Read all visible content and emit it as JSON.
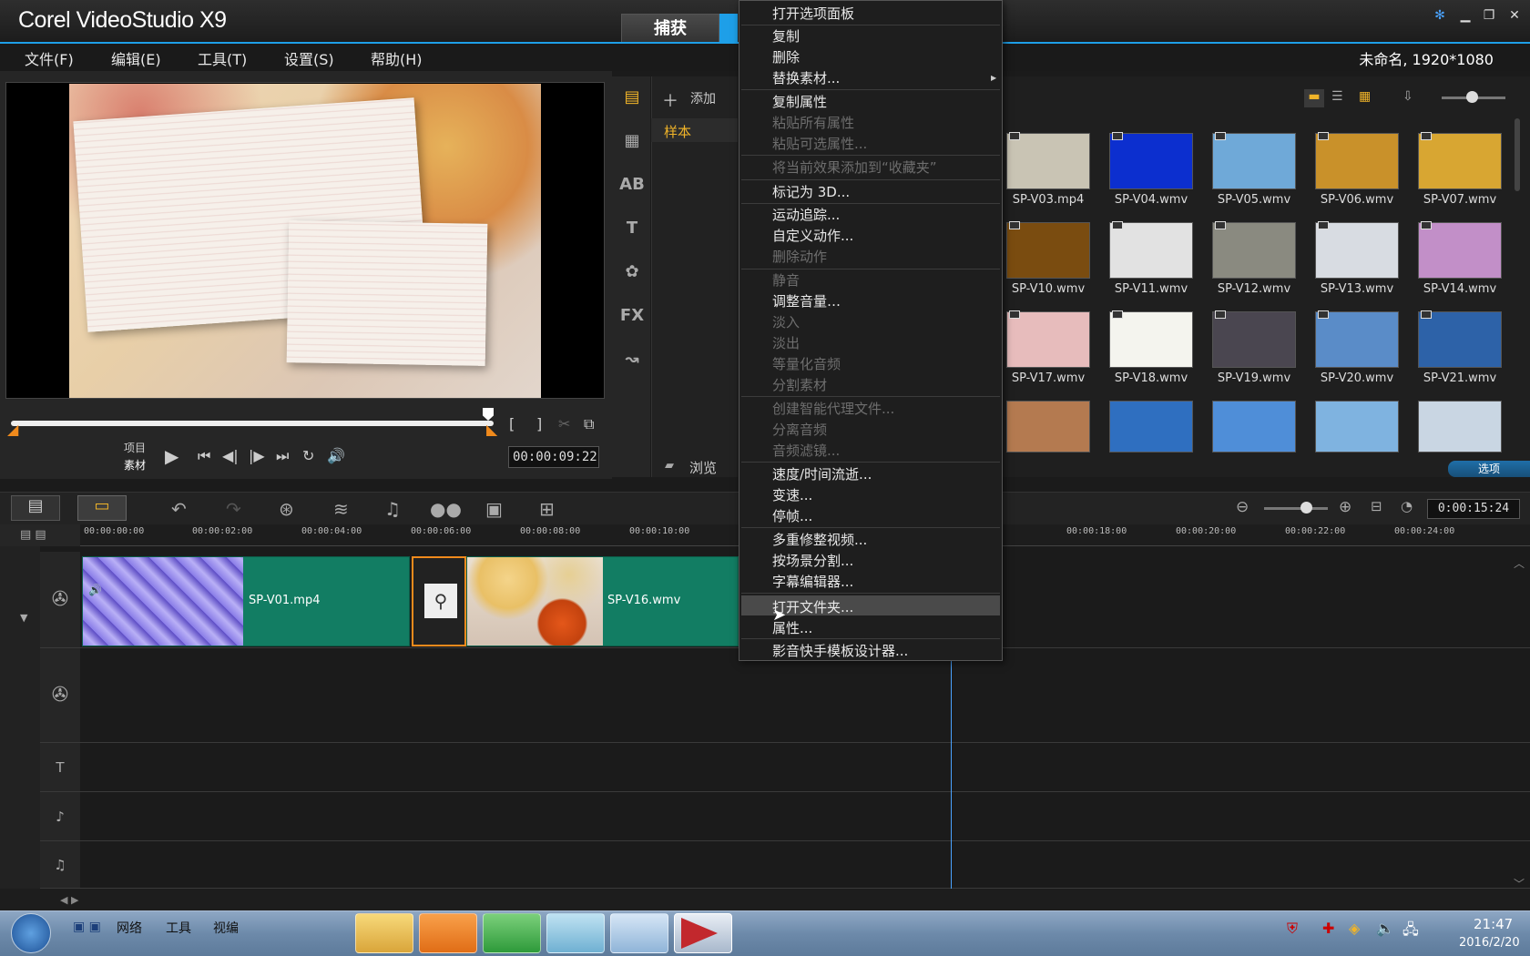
{
  "app": {
    "title": "Corel VideoStudio X9",
    "tab_capture": "捕获",
    "project_info": "未命名, 1920*1080"
  },
  "menubar": {
    "file": "文件(F)",
    "edit": "编辑(E)",
    "tools": "工具(T)",
    "settings": "设置(S)",
    "help": "帮助(H)"
  },
  "player": {
    "mode_project": "项目",
    "mode_clip": "素材",
    "timecode": "00:00:09:22"
  },
  "library": {
    "add_label": "添加",
    "folder_sample": "样本",
    "browse_label": "浏览",
    "options_label": "选项",
    "thumbnails": [
      {
        "name": "SP-V03.mp4",
        "color": "#c9c4b4"
      },
      {
        "name": "SP-V04.wmv",
        "color": "#0c2fcf"
      },
      {
        "name": "SP-V05.wmv",
        "color": "#6fa9d8"
      },
      {
        "name": "SP-V06.wmv",
        "color": "#c9912a"
      },
      {
        "name": "SP-V07.wmv",
        "color": "#d8a632"
      },
      {
        "name": "SP-V10.wmv",
        "color": "#7a4c10"
      },
      {
        "name": "SP-V11.wmv",
        "color": "#e2e2e2"
      },
      {
        "name": "SP-V12.wmv",
        "color": "#8a8a80"
      },
      {
        "name": "SP-V13.wmv",
        "color": "#d8dce2"
      },
      {
        "name": "SP-V14.wmv",
        "color": "#c28fc8"
      },
      {
        "name": "SP-V17.wmv",
        "color": "#e7bcbc"
      },
      {
        "name": "SP-V18.wmv",
        "color": "#f4f4ee"
      },
      {
        "name": "SP-V19.wmv",
        "color": "#4a4650"
      },
      {
        "name": "SP-V20.wmv",
        "color": "#5a8cc8"
      },
      {
        "name": "SP-V21.wmv",
        "color": "#2d62a8"
      }
    ],
    "bottom_row_colors": [
      "#b47a50",
      "#2f6fc0",
      "#4f8ed8",
      "#7fb3e0",
      "#c9d6e3"
    ]
  },
  "timeline": {
    "timecode": "0:00:15:24",
    "ruler": [
      "00:00:00:00",
      "00:00:02:00",
      "00:00:04:00",
      "00:00:06:00",
      "00:00:08:00",
      "00:00:10:00",
      "00:00:18:00",
      "00:00:20:00",
      "00:00:22:00",
      "00:00:24:00"
    ],
    "clip1_name": "SP-V01.mp4",
    "clip2_name": "SP-V16.wmv"
  },
  "context_menu": {
    "items": [
      {
        "label": "打开选项面板",
        "disabled": false
      },
      {
        "label": "复制",
        "disabled": false
      },
      {
        "label": "删除",
        "disabled": false
      },
      {
        "label": "替换素材...",
        "disabled": false,
        "submenu": true
      },
      {
        "label": "复制属性",
        "disabled": false
      },
      {
        "label": "粘贴所有属性",
        "disabled": true
      },
      {
        "label": "粘贴可选属性...",
        "disabled": true
      },
      {
        "label": "将当前效果添加到“收藏夹”",
        "disabled": true
      },
      {
        "label": "标记为 3D...",
        "disabled": false
      },
      {
        "label": "运动追踪...",
        "disabled": false
      },
      {
        "label": "自定义动作...",
        "disabled": false
      },
      {
        "label": "删除动作",
        "disabled": true
      },
      {
        "label": "静音",
        "disabled": true
      },
      {
        "label": "调整音量…",
        "disabled": false
      },
      {
        "label": "淡入",
        "disabled": true
      },
      {
        "label": "淡出",
        "disabled": true
      },
      {
        "label": "等量化音频",
        "disabled": true
      },
      {
        "label": "分割素材",
        "disabled": true
      },
      {
        "label": "创建智能代理文件...",
        "disabled": true
      },
      {
        "label": "分离音频",
        "disabled": true
      },
      {
        "label": "音频滤镜...",
        "disabled": true
      },
      {
        "label": "速度/时间流逝...",
        "disabled": false
      },
      {
        "label": "变速...",
        "disabled": false
      },
      {
        "label": "停帧...",
        "disabled": false
      },
      {
        "label": "多重修整视频...",
        "disabled": false
      },
      {
        "label": "按场景分割...",
        "disabled": false
      },
      {
        "label": "字幕编辑器...",
        "disabled": false
      },
      {
        "label": "打开文件夹...",
        "disabled": false,
        "highlighted": true
      },
      {
        "label": "属性...",
        "disabled": false
      },
      {
        "label": "影音快手模板设计器...",
        "disabled": false
      }
    ]
  },
  "taskbar": {
    "network": "网络",
    "tools": "工具",
    "video": "视编",
    "time": "21:47",
    "date": "2016/2/20"
  }
}
